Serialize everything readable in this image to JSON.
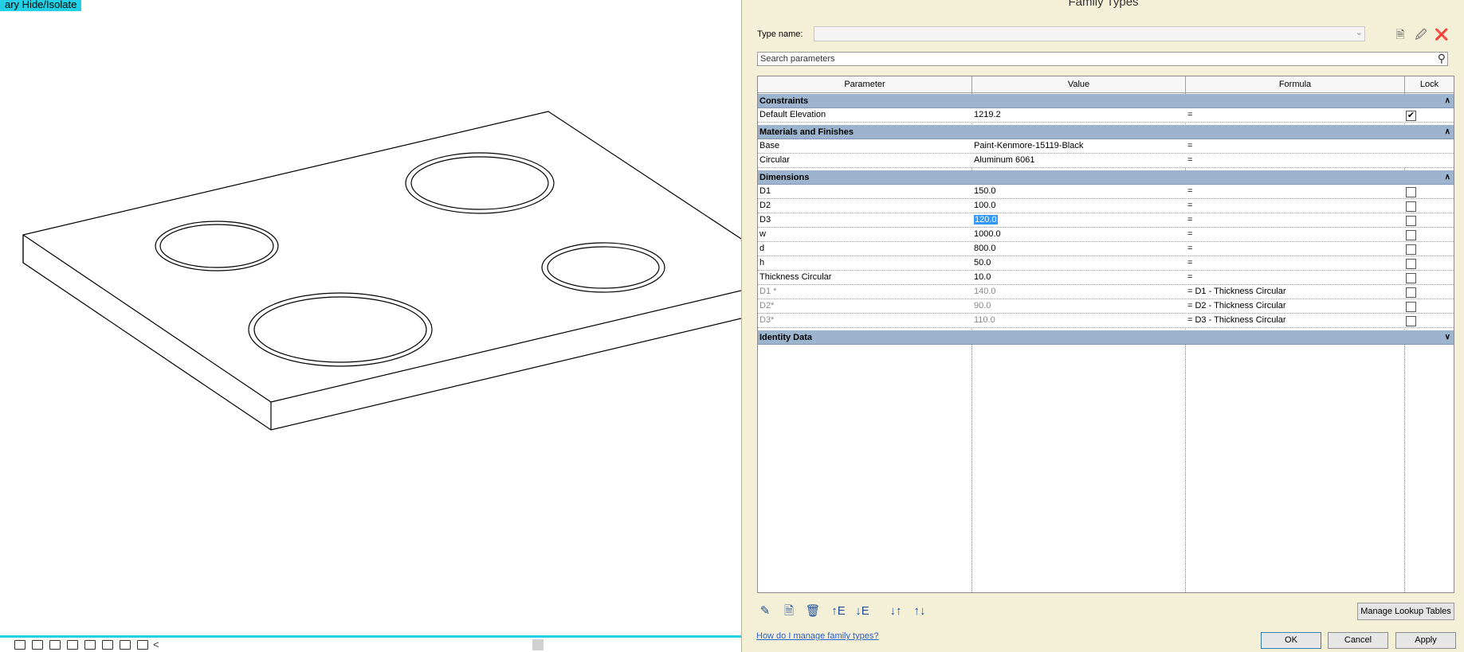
{
  "viewport": {
    "temp_label": "ary Hide/Isolate",
    "scroll_arrow": "<"
  },
  "dialog": {
    "title": "Family Types",
    "type_name_label": "Type name:",
    "type_name_value": "",
    "search_placeholder": "Search parameters",
    "columns": [
      "Parameter",
      "Value",
      "Formula",
      "Lock"
    ],
    "groups": [
      {
        "name": "Constraints",
        "rows": [
          {
            "param": "Default Elevation",
            "value": "1219.2",
            "formula": "=",
            "lock": true
          }
        ]
      },
      {
        "name": "Materials and Finishes",
        "rows": [
          {
            "param": "Base",
            "value": "Paint-Kenmore-15119-Black",
            "formula": "="
          },
          {
            "param": "Circular",
            "value": "Aluminum 6061",
            "formula": "="
          }
        ]
      },
      {
        "name": "Dimensions",
        "rows": [
          {
            "param": "D1",
            "value": "150.0",
            "formula": "=",
            "lock": false
          },
          {
            "param": "D2",
            "value": "100.0",
            "formula": "=",
            "lock": false
          },
          {
            "param": "D3",
            "value": "120.0",
            "formula": "=",
            "lock": false,
            "selected": true
          },
          {
            "param": "w",
            "value": "1000.0",
            "formula": "=",
            "lock": false
          },
          {
            "param": "d",
            "value": "800.0",
            "formula": "=",
            "lock": false
          },
          {
            "param": "h",
            "value": "50.0",
            "formula": "=",
            "lock": false
          },
          {
            "param": "Thickness Circular",
            "value": "10.0",
            "formula": "=",
            "lock": false
          },
          {
            "param": "D1 *",
            "value": "140.0",
            "formula": "= D1 - Thickness Circular",
            "lock": false,
            "dim": true
          },
          {
            "param": "D2*",
            "value": "90.0",
            "formula": "= D2 - Thickness Circular",
            "lock": false,
            "dim": true
          },
          {
            "param": "D3*",
            "value": "110.0",
            "formula": "= D3 - Thickness Circular",
            "lock": false,
            "dim": true
          }
        ]
      },
      {
        "name": "Identity Data",
        "collapsed": true,
        "rows": []
      }
    ],
    "manage_lookup_label": "Manage Lookup Tables",
    "help_link": "How do I manage family types?",
    "ok_label": "OK",
    "cancel_label": "Cancel",
    "apply_label": "Apply"
  }
}
